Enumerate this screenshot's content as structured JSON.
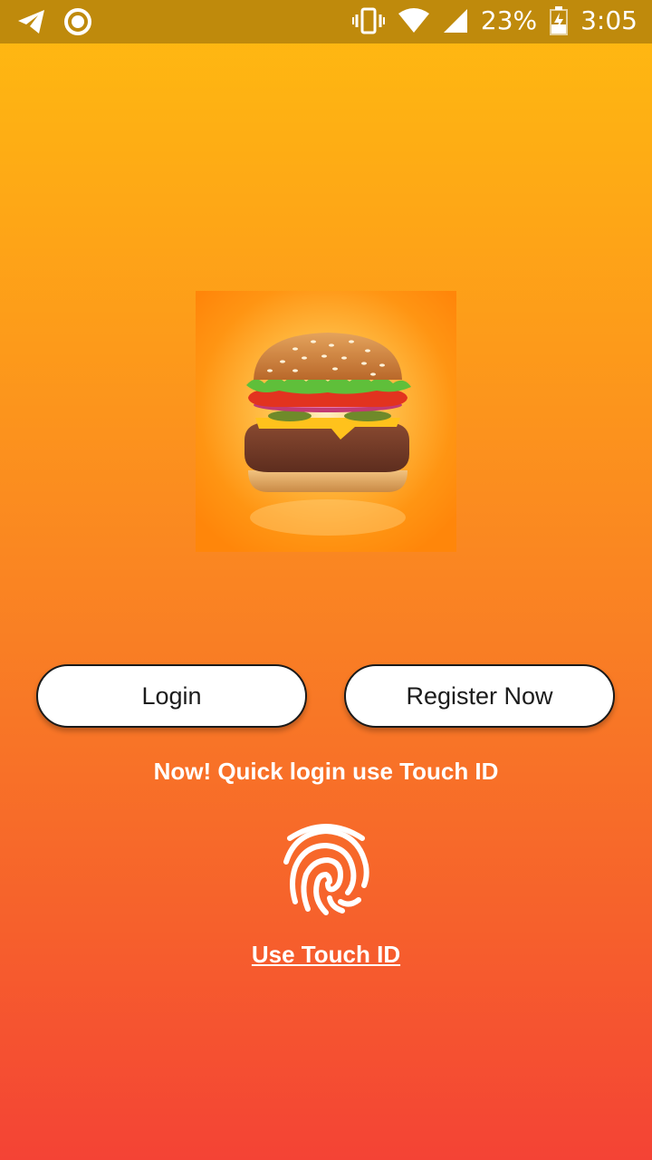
{
  "status_bar": {
    "battery_percent": "23%",
    "time": "3:05",
    "icons": [
      "telegram-icon",
      "circle-notification-icon",
      "vibrate-icon",
      "wifi-icon",
      "signal-icon",
      "battery-charging-icon"
    ]
  },
  "hero": {
    "image": "burger-image"
  },
  "actions": {
    "login_label": "Login",
    "register_label": "Register Now"
  },
  "touch_id": {
    "prompt": "Now! Quick login use Touch ID",
    "link_label": "Use Touch ID",
    "icon": "fingerprint-icon"
  },
  "colors": {
    "gradient_top": "#ffbb10",
    "gradient_bottom": "#f44335",
    "status_bar": "#bf8a0c",
    "button_bg": "#ffffff"
  }
}
